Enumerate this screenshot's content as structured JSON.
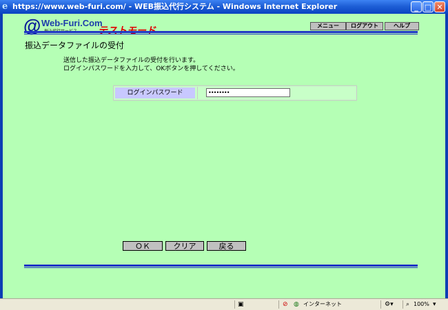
{
  "window": {
    "title": "https://www.web-furi.com/ - WEB振込代行システム - Windows Internet Explorer",
    "controls": {
      "minimize": "_",
      "maximize": "□",
      "close": "✕"
    }
  },
  "header": {
    "logo_at": "@",
    "logo_text": "Web-Furi.Com",
    "logo_subtitle": "振込代行サービス",
    "mode_label": "テストモード",
    "nav": {
      "menu": "メニュー",
      "logout": "ログアウト",
      "help": "ヘルプ"
    }
  },
  "page": {
    "title": "振込データファイルの受付",
    "instructions": [
      "送信した振込データファイルの受付を行います。",
      "ログインパスワードを入力して、OKボタンを押してください。"
    ]
  },
  "form": {
    "password_label": "ログインパスワード",
    "password_value": "••••••••"
  },
  "buttons": {
    "ok": "ＯＫ",
    "clear": "クリア",
    "back": "戻る"
  },
  "statusbar": {
    "zone": "インターネット",
    "zoom": "100%"
  },
  "colors": {
    "background": "#b5ffb5",
    "rule": "#1f35c6",
    "label_cell": "#c8c8ff",
    "mode": "#e00000"
  }
}
